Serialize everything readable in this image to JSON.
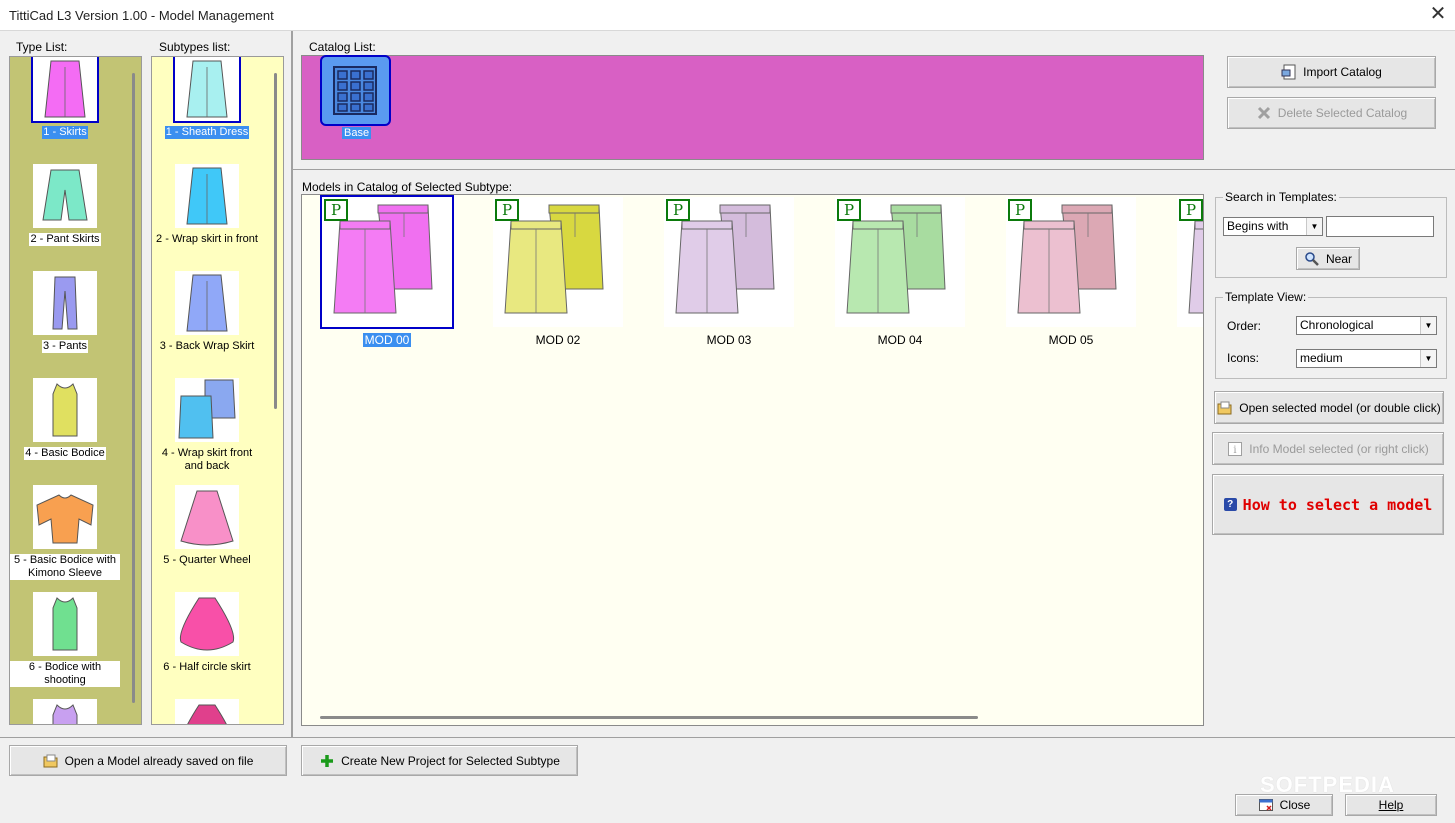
{
  "window": {
    "title": "TittiCad L3 Version 1.00 - Model Management",
    "close_glyph": "✕"
  },
  "labels": {
    "type_list": "Type List:",
    "subtypes_list": "Subtypes list:",
    "catalog_list": "Catalog List:",
    "models_in_catalog": "Models in Catalog of Selected Subtype:"
  },
  "type_list": [
    {
      "label": "1 - Skirts",
      "color": "#f46cf4",
      "icon": "skirt-icon",
      "selected": true
    },
    {
      "label": "2 - Pant Skirts",
      "color": "#7ce8c8",
      "icon": "pant-skirt-icon"
    },
    {
      "label": "3 - Pants",
      "color": "#9a9af0",
      "icon": "pants-icon"
    },
    {
      "label": "4 - Basic Bodice",
      "color": "#e0e060",
      "icon": "bodice-icon"
    },
    {
      "label": "5 - Basic Bodice with Kimono Sleeve",
      "color": "#f8a050",
      "icon": "kimono-bodice-icon"
    },
    {
      "label": "6 - Bodice with shooting",
      "color": "#70e090",
      "icon": "bodice-shooting-icon"
    },
    {
      "label": "",
      "color": "#c8a0f0",
      "icon": "bodice-partial-icon"
    }
  ],
  "subtypes_list": [
    {
      "label": "1 - Sheath Dress",
      "color": "#a8f0f0",
      "icon": "sheath-skirt-icon",
      "selected": true
    },
    {
      "label": "2 - Wrap skirt in front",
      "color": "#40c8f8",
      "icon": "wrap-front-icon"
    },
    {
      "label": "3 - Back Wrap Skirt",
      "color": "#90a8f8",
      "icon": "back-wrap-icon"
    },
    {
      "label": "4 - Wrap skirt front and back",
      "color": "#50c0f0",
      "icon": "wrap-front-back-icon"
    },
    {
      "label": "5 - Quarter Wheel",
      "color": "#f890c8",
      "icon": "quarter-wheel-icon"
    },
    {
      "label": "6 - Half circle skirt",
      "color": "#f850a8",
      "icon": "half-circle-icon"
    },
    {
      "label": "",
      "color": "#e0408c",
      "icon": "skirt-partial-icon"
    }
  ],
  "catalogs": [
    {
      "label": "Base",
      "icon": "grid-catalog-icon"
    }
  ],
  "models": [
    {
      "label": "MOD 00",
      "badge": "P",
      "front": "#f47cf4",
      "back": "#f070f0",
      "selected": true
    },
    {
      "label": "MOD 02",
      "badge": "P",
      "front": "#e8e880",
      "back": "#d8d840"
    },
    {
      "label": "MOD 03",
      "badge": "P",
      "front": "#e0cce8",
      "back": "#d4bcdc"
    },
    {
      "label": "MOD 04",
      "badge": "P",
      "front": "#b8e8b0",
      "back": "#a8dca0"
    },
    {
      "label": "MOD 05",
      "badge": "P",
      "front": "#ecc0d0",
      "back": "#dca8b4"
    },
    {
      "label": "",
      "badge": "P",
      "front": "#e0cce8",
      "back": "#d4bcdc"
    }
  ],
  "buttons": {
    "import_catalog": "Import Catalog",
    "delete_catalog": "Delete Selected Catalog",
    "near": "Near",
    "open_selected": "Open selected model (or double click)",
    "info_model": "Info Model selected (or right click)",
    "how_to": "How to select a model",
    "open_saved": "Open a Model already saved on file",
    "create_new": "Create New Project for Selected Subtype",
    "close": "Close",
    "help": "Help"
  },
  "search": {
    "title": "Search in Templates:",
    "mode": "Begins with",
    "value": ""
  },
  "template_view": {
    "title": "Template View:",
    "order_label": "Order:",
    "order_value": "Chronological",
    "icons_label": "Icons:",
    "icons_value": "medium"
  },
  "watermark": "SOFTPEDIA"
}
